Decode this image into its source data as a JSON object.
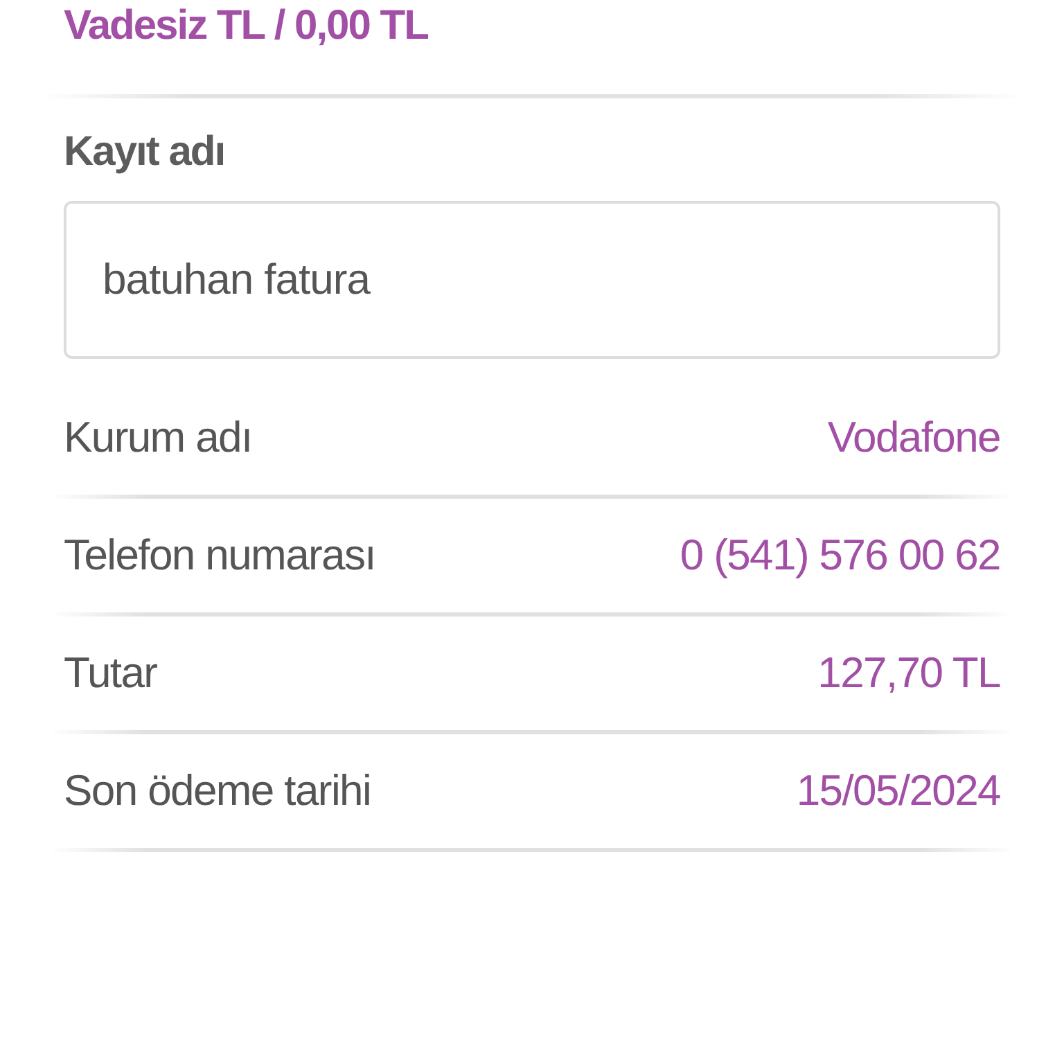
{
  "balance_summary": "Vadesiz TL / 0,00 TL",
  "save_name": {
    "label": "Kayıt adı",
    "value": "batuhan fatura"
  },
  "details": [
    {
      "label": "Kurum adı",
      "value": "Vodafone"
    },
    {
      "label": "Telefon numarası",
      "value": "0 (541) 576 00 62"
    },
    {
      "label": "Tutar",
      "value": "127,70 TL"
    },
    {
      "label": "Son ödeme tarihi",
      "value": "15/05/2024"
    }
  ]
}
